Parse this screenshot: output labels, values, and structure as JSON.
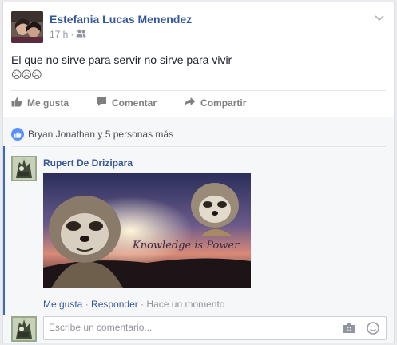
{
  "post": {
    "author": "Estefania Lucas Menendez",
    "time": "17 h",
    "separator": "·",
    "text": "El que no sirve para servir no sirve para vivir",
    "emojis": "☹☹☹"
  },
  "actions": {
    "like": "Me gusta",
    "comment": "Comentar",
    "share": "Compartir"
  },
  "reactions": {
    "summary": "Bryan Jonathan y 5 personas más"
  },
  "comment": {
    "author": "Rupert De Drizipara",
    "image_caption": "Knowledge is Power",
    "like": "Me gusta",
    "dot1": " · ",
    "reply": "Responder",
    "dot2": " · ",
    "time": "Hace un momento"
  },
  "write_comment": {
    "placeholder": "Escribe un comentario..."
  },
  "icons": {
    "audience": "friends-icon",
    "menu": "chevron-down-icon",
    "like": "thumbs-up-icon",
    "comment": "comment-icon",
    "share": "share-arrow-icon",
    "camera": "camera-icon",
    "emoji": "smiley-icon"
  },
  "colors": {
    "link": "#365899",
    "meta": "#90949c",
    "like_blue": "#5890ff",
    "accent_bar": "#4267b2"
  }
}
